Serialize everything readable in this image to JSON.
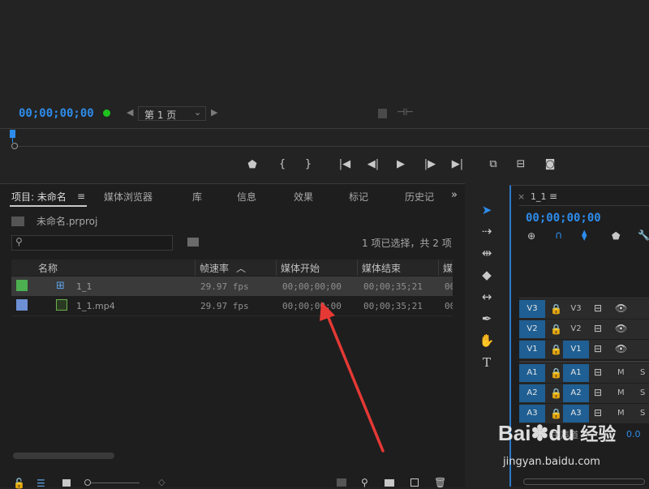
{
  "monitor": {
    "timecode": "00;00;00;00",
    "page_select": "第 1 页",
    "accent": "#2d8ceb",
    "dot_color": "#1ec31e"
  },
  "project": {
    "tabs": [
      "项目: 未命名",
      "媒体浏览器",
      "库",
      "信息",
      "效果",
      "标记",
      "历史记"
    ],
    "file_name": "未命名.prproj",
    "selection_status": "1 项已选择，共 2 项",
    "columns": [
      "名称",
      "帧速率",
      "媒体开始",
      "媒体结束",
      "媒"
    ],
    "rows": [
      {
        "swatch": "#4caf50",
        "name": "1_1",
        "fps": "29.97 fps",
        "start": "00;00;00;00",
        "end": "00;00;35;21",
        "extra": "00"
      },
      {
        "swatch": "#6d8fd4",
        "name": "1_1.mp4",
        "fps": "29.97 fps",
        "start": "00;00;00;00",
        "end": "00;00;35;21",
        "extra": "00"
      }
    ]
  },
  "timeline": {
    "sequence_name": "1_1",
    "timecode": "00;00;00;00",
    "video_tracks": [
      {
        "source": "V3",
        "target": "V3"
      },
      {
        "source": "V2",
        "target": "V2"
      },
      {
        "source": "V1",
        "target": "V1"
      }
    ],
    "audio_tracks": [
      {
        "source": "A1",
        "target": "A1",
        "m": "M",
        "s": "S"
      },
      {
        "source": "A2",
        "target": "A2",
        "m": "M",
        "s": "S"
      },
      {
        "source": "A3",
        "target": "A3",
        "m": "M",
        "s": "S"
      }
    ],
    "master_label": "主声道",
    "master_value": "0.0"
  },
  "watermark": {
    "brand": "Bai",
    "brand2": "du",
    "cn": "经验",
    "url": "jingyan.baidu.com"
  }
}
